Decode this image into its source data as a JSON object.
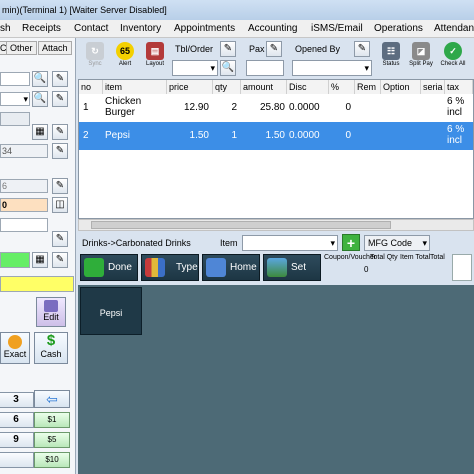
{
  "window": {
    "title": "min)(Terminal 1) [Waiter Server Disabled]"
  },
  "menu": [
    "sh",
    "Receipts",
    "Contact",
    "Inventory",
    "Appointments",
    "Accounting",
    "iSMS/Email",
    "Operations",
    "Attendan"
  ],
  "left": {
    "tabs": [
      "Cust",
      "Other",
      "Attach"
    ],
    "digits_fragment": "34",
    "number_fragment": "6",
    "zero_value": "0",
    "edit_label": "Edit",
    "exact_label": "Exact",
    "cash_label": "Cash",
    "numpad": [
      "3",
      "6",
      "9"
    ],
    "cash_buttons": [
      "$1",
      "$5",
      "$10"
    ]
  },
  "toolbar": {
    "sync": "Sync",
    "alert": "Alert",
    "alert_badge": "65",
    "layout": "Layout",
    "tbl_order": "Tbl/Order",
    "pax": "Pax",
    "opened_by": "Opened By",
    "status": "Status",
    "split_pay": "Split Pay",
    "check_all": "Check All"
  },
  "grid": {
    "headers": [
      "no",
      "item",
      "price",
      "qty",
      "amount",
      "Disc",
      "%",
      "Rem",
      "Option",
      "seria",
      "tax"
    ],
    "rows": [
      {
        "no": "1",
        "item": "Chicken Burger",
        "price": "12.90",
        "qty": "2",
        "amount": "25.80",
        "disc": "0.0000",
        "pct": "0",
        "tax": "6 % incl"
      },
      {
        "no": "2",
        "item": "Pepsi",
        "price": "1.50",
        "qty": "1",
        "amount": "1.50",
        "disc": "0.0000",
        "pct": "0",
        "tax": "6 % incl"
      }
    ]
  },
  "category": {
    "path": "Drinks->Carbonated Drinks",
    "item_label": "Item",
    "mfg_code": "MFG Code",
    "coupon_label": "Coupon/Voucher",
    "coupon_value": "0",
    "total_qty_label": "Total Qty",
    "item_total_label": "Item Total",
    "total_label": "Total"
  },
  "nav": {
    "done": "Done",
    "type": "Type",
    "home": "Home",
    "set": "Set"
  },
  "items": [
    {
      "name": "Pepsi"
    }
  ],
  "colors": {
    "selected_row": "#3c8ee7",
    "item_area": "#4d6a76",
    "nav_button": "#1d3644",
    "cash_green": "#b9e7b9",
    "yellow_field": "#ffff66",
    "green_field": "#66ee66",
    "peach_field": "#fde0c0"
  }
}
